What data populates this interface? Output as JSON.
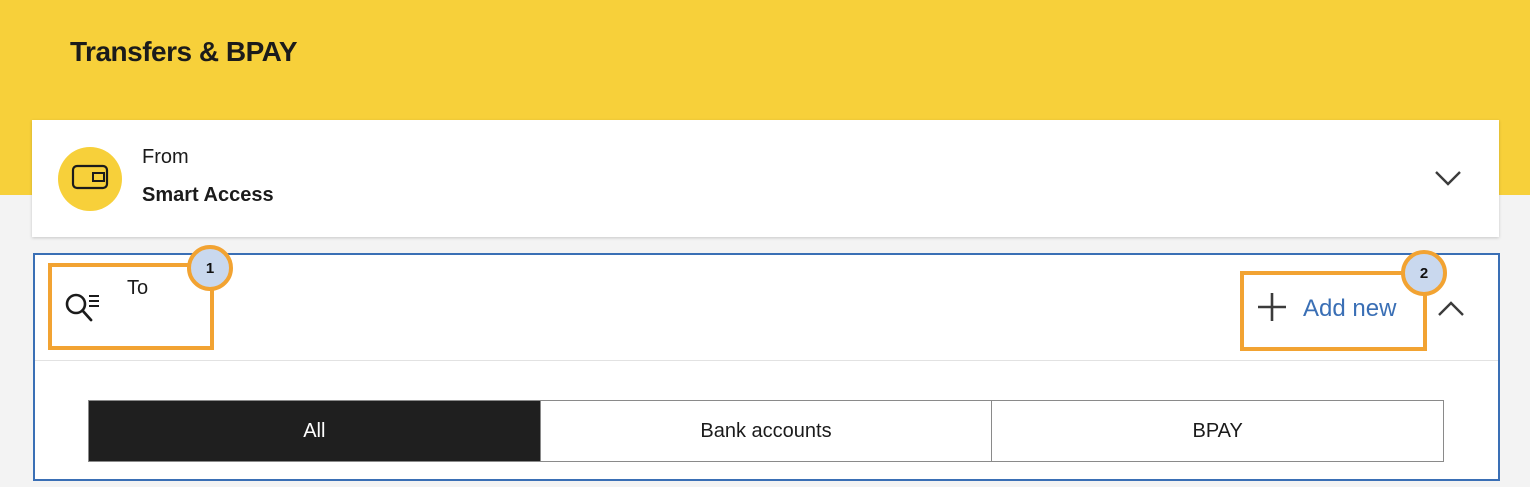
{
  "header": {
    "title": "Transfers & BPAY"
  },
  "from": {
    "label": "From",
    "account_name": "Smart Access",
    "icon": "wallet-icon",
    "chevron_icon": "chevron-down-icon"
  },
  "to": {
    "label": "To",
    "icon": "search-list-icon",
    "add_new_label": "Add new",
    "add_icon": "plus-icon",
    "collapse_icon": "chevron-up-icon"
  },
  "filter_tabs": [
    {
      "label": "All",
      "selected": true
    },
    {
      "label": "Bank accounts",
      "selected": false
    },
    {
      "label": "BPAY",
      "selected": false
    }
  ],
  "annotations": [
    {
      "number": "1"
    },
    {
      "number": "2"
    }
  ],
  "colors": {
    "brand_yellow": "#f7d03a",
    "link_blue": "#3a6fb5",
    "annotation_orange": "#f2a332",
    "annotation_badge": "#c9d8ee",
    "active_tab": "#1f1f1f"
  }
}
